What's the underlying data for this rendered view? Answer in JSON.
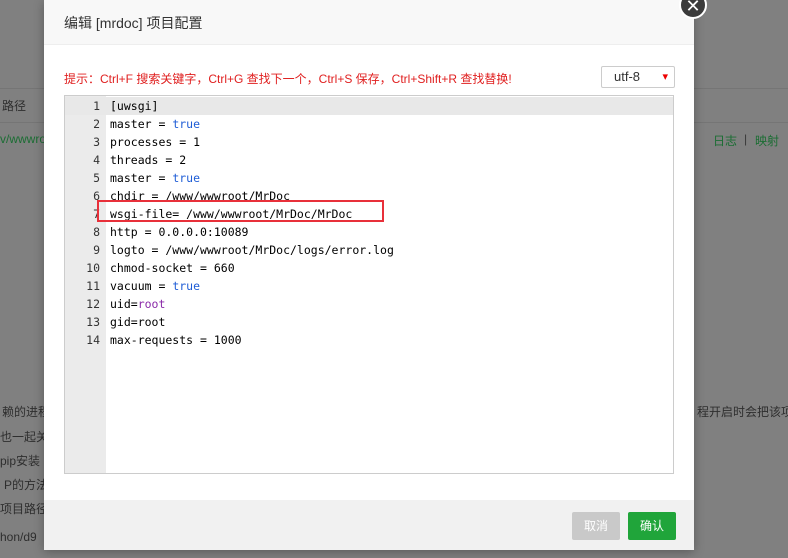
{
  "background": {
    "col_path_label": "路径",
    "row_path": "v/wwwro",
    "log_link": "日志",
    "sep": "|",
    "map_link": "映射",
    "frag1": "赖的进程",
    "frag2": "也一起关",
    "frag3": "pip安装",
    "frag4": "P的方法",
    "frag5": "项目路径",
    "frag6": "hon/d9",
    "frag_right": "程开启时会把该项"
  },
  "modal": {
    "title": "编辑 [mrdoc] 项目配置",
    "close_glyph": "✕",
    "hint": "提示：Ctrl+F 搜索关键字，Ctrl+G 查找下一个，Ctrl+S 保存，Ctrl+Shift+R 查找替换!",
    "encoding": "utf-8",
    "encoding_chevron": "▾",
    "lines": [
      {
        "n": "1",
        "parts": [
          {
            "t": "[uwsgi]",
            "c": "plain"
          }
        ]
      },
      {
        "n": "2",
        "parts": [
          {
            "t": "master = ",
            "c": "plain"
          },
          {
            "t": "true",
            "c": "kw"
          }
        ]
      },
      {
        "n": "3",
        "parts": [
          {
            "t": "processes = 1",
            "c": "plain"
          }
        ]
      },
      {
        "n": "4",
        "parts": [
          {
            "t": "threads = 2",
            "c": "plain"
          }
        ]
      },
      {
        "n": "5",
        "parts": [
          {
            "t": "master = ",
            "c": "plain"
          },
          {
            "t": "true",
            "c": "kw"
          }
        ]
      },
      {
        "n": "6",
        "parts": [
          {
            "t": "chdir = /www/wwwroot/MrDoc",
            "c": "plain"
          }
        ]
      },
      {
        "n": "7",
        "parts": [
          {
            "t": "wsgi-file= /www/wwwroot/MrDoc/MrDoc",
            "c": "plain"
          }
        ]
      },
      {
        "n": "8",
        "parts": [
          {
            "t": "http = 0.0.0.0:10089",
            "c": "plain"
          }
        ]
      },
      {
        "n": "9",
        "parts": [
          {
            "t": "logto = /www/wwwroot/MrDoc/logs/error.log",
            "c": "plain"
          }
        ]
      },
      {
        "n": "10",
        "parts": [
          {
            "t": "chmod-socket = 660",
            "c": "plain"
          }
        ]
      },
      {
        "n": "11",
        "parts": [
          {
            "t": "vacuum = ",
            "c": "plain"
          },
          {
            "t": "true",
            "c": "kw"
          }
        ]
      },
      {
        "n": "12",
        "parts": [
          {
            "t": "uid=",
            "c": "plain"
          },
          {
            "t": "root",
            "c": "att"
          }
        ]
      },
      {
        "n": "13",
        "parts": [
          {
            "t": "gid=root",
            "c": "plain"
          }
        ]
      },
      {
        "n": "14",
        "parts": [
          {
            "t": "max-requests = 1000",
            "c": "plain"
          }
        ]
      }
    ],
    "cancel_label": "取消",
    "confirm_label": "确认"
  },
  "colors": {
    "keyword": "#1f5dd6",
    "atom": "#8a2aa8",
    "hint": "#e02020",
    "confirm": "#20a53a",
    "highlight": "#e8303a"
  }
}
